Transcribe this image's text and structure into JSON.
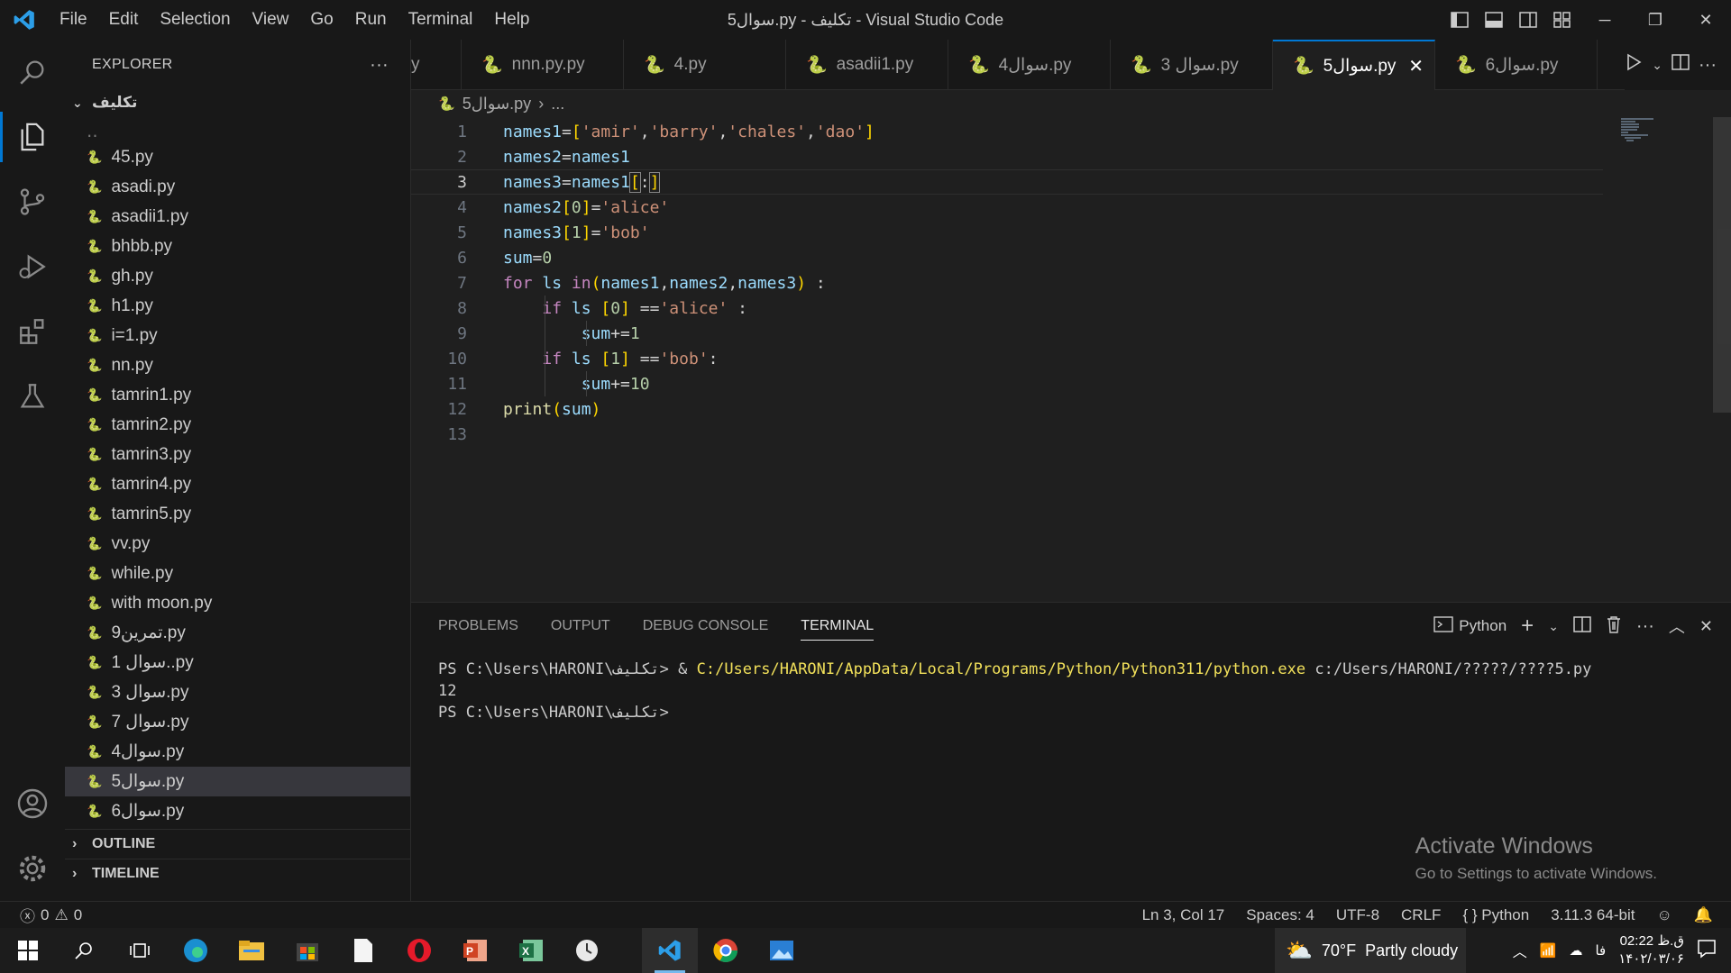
{
  "window": {
    "title": "5سوال.py - تکلیف - Visual Studio Code"
  },
  "menu": [
    "File",
    "Edit",
    "Selection",
    "View",
    "Go",
    "Run",
    "Terminal",
    "Help"
  ],
  "explorer": {
    "title": "EXPLORER",
    "more": "···",
    "folder": "تکلیف",
    "files": [
      "45.py",
      "asadi.py",
      "asadii1.py",
      "bhbb.py",
      "gh.py",
      "h1.py",
      "i=1.py",
      "nn.py",
      "tamrin1.py",
      "tamrin2.py",
      "tamrin3.py",
      "tamrin4.py",
      "tamrin5.py",
      "vv.py",
      "while.py",
      "with moon.py",
      "9تمرین.py",
      "1 سوال..py",
      "3 سوال.py",
      "7 سوال.py",
      "4سوال.py",
      "5سوال.py",
      "6سوال.py"
    ],
    "selected_file": "5سوال.py",
    "outline": "OUTLINE",
    "timeline": "TIMELINE"
  },
  "tabs": [
    {
      "label": "y"
    },
    {
      "label": "nnn.py.py"
    },
    {
      "label": "4.py"
    },
    {
      "label": "asadii1.py"
    },
    {
      "label": "4سوال.py"
    },
    {
      "label": "3 سوال.py"
    },
    {
      "label": "5سوال.py"
    },
    {
      "label": "6سوال.py"
    }
  ],
  "active_tab": "5سوال.py",
  "breadcrumb": {
    "file": "5سوال.py",
    "rest": "..."
  },
  "editor": {
    "line_numbers": [
      "1",
      "2",
      "3",
      "4",
      "5",
      "6",
      "7",
      "8",
      "9",
      "10",
      "11",
      "12",
      "13"
    ],
    "current_line": 3
  },
  "panel": {
    "tabs": [
      "PROBLEMS",
      "OUTPUT",
      "DEBUG CONSOLE",
      "TERMINAL"
    ],
    "active_tab": "TERMINAL",
    "shell": "Python",
    "term_prompt1": "PS C:\\Users\\HARONI\\تکلیف> & ",
    "term_exe": "C:/Users/HARONI/AppData/Local/Programs/Python/Python311/python.exe",
    "term_arg": " c:/Users/HARONI/?????/????5.py",
    "term_output": "12",
    "term_prompt2": "PS C:\\Users\\HARONI\\تکلیف>",
    "activate_title": "Activate Windows",
    "activate_sub": "Go to Settings to activate Windows."
  },
  "status": {
    "errors": "0",
    "warnings": "0",
    "position": "Ln 3, Col 17",
    "spaces": "Spaces: 4",
    "encoding": "UTF-8",
    "eol": "CRLF",
    "language": "Python",
    "interpreter": "3.11.3 64-bit"
  },
  "taskbar": {
    "weather_temp": "70°F",
    "weather_desc": "Partly cloudy",
    "lang": "فا",
    "time": "02:22 ق.ظ",
    "date": "۱۴۰۲/۰۳/۰۶"
  },
  "colors": {
    "accent": "#0078d4",
    "bg": "#1f1f1f",
    "sidebar": "#181818"
  }
}
